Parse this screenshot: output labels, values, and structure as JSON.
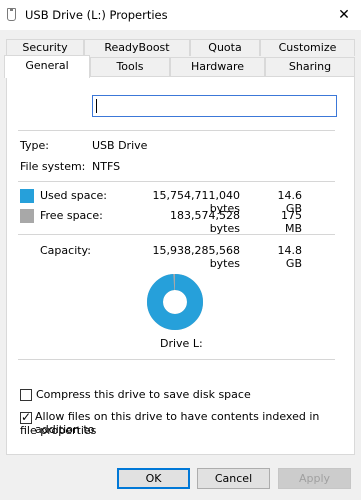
{
  "window": {
    "title": "USB Drive (L:) Properties",
    "close_glyph": "✕"
  },
  "tabs_row1": [
    "Security",
    "ReadyBoost",
    "Quota",
    "Customize"
  ],
  "tabs_row2": [
    "General",
    "Tools",
    "Hardware",
    "Sharing"
  ],
  "selected_tab": "General",
  "name_field": {
    "value": ""
  },
  "info": {
    "type_label": "Type:",
    "type_value": "USB Drive",
    "fs_label": "File system:",
    "fs_value": "NTFS"
  },
  "usage": {
    "used_label": "Used space:",
    "used_bytes": "15,754,711,040 bytes",
    "used_size": "14.6 GB",
    "used_color": "#26a0da",
    "free_label": "Free space:",
    "free_bytes": "183,574,528 bytes",
    "free_size": "175 MB",
    "free_color": "#a8a8a8",
    "capacity_label": "Capacity:",
    "capacity_bytes": "15,938,285,568 bytes",
    "capacity_size": "14.8 GB",
    "used_fraction": 0.9885
  },
  "drive_label": "Drive L:",
  "options": {
    "compress_label": "Compress this drive to save disk space",
    "compress_checked": false,
    "index_label_line1": "Allow files on this drive to have contents indexed in addition to",
    "index_label_line2": "file properties",
    "index_checked": true
  },
  "buttons": {
    "ok": "OK",
    "cancel": "Cancel",
    "apply": "Apply"
  }
}
